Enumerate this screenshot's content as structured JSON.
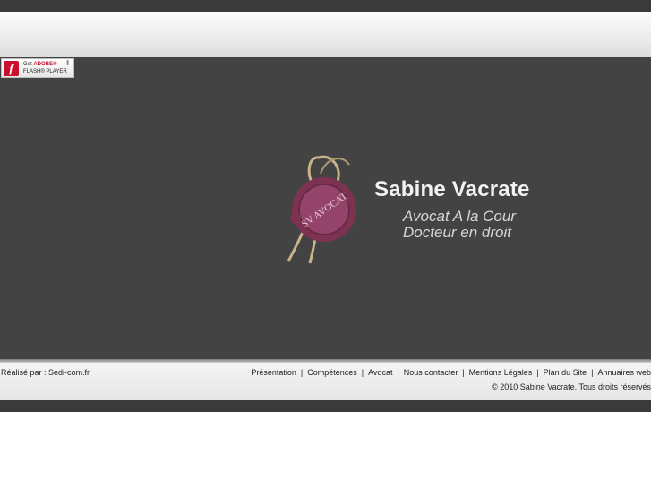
{
  "flash_badge": {
    "line1_prefix": "Get",
    "line1_brand": "ADOBE®",
    "line2": "FLASH® PLAYER",
    "icon": "flash-player-icon",
    "download_icon": "download-arrow-icon"
  },
  "brand": {
    "name": "Sabine Vacrate",
    "subtitle1": "Avocat A la Cour",
    "subtitle2": "Docteur en droit",
    "seal_text": "SV AVOCAT",
    "seal_color": "#8a3a5a"
  },
  "footer": {
    "credit_prefix": "Réalisé par :",
    "credit_link": "Sedi-com.fr",
    "nav": [
      "Présentation",
      "Compétences",
      "Avocat",
      "Nous contacter",
      "Mentions Légales",
      "Plan du Site",
      "Annuaires web"
    ],
    "copyright": "© 2010 Sabine Vacrate. Tous droits réservés"
  },
  "colors": {
    "background": "#434343",
    "top_bar": "#3a3a3a",
    "flash_red": "#c8102e"
  }
}
